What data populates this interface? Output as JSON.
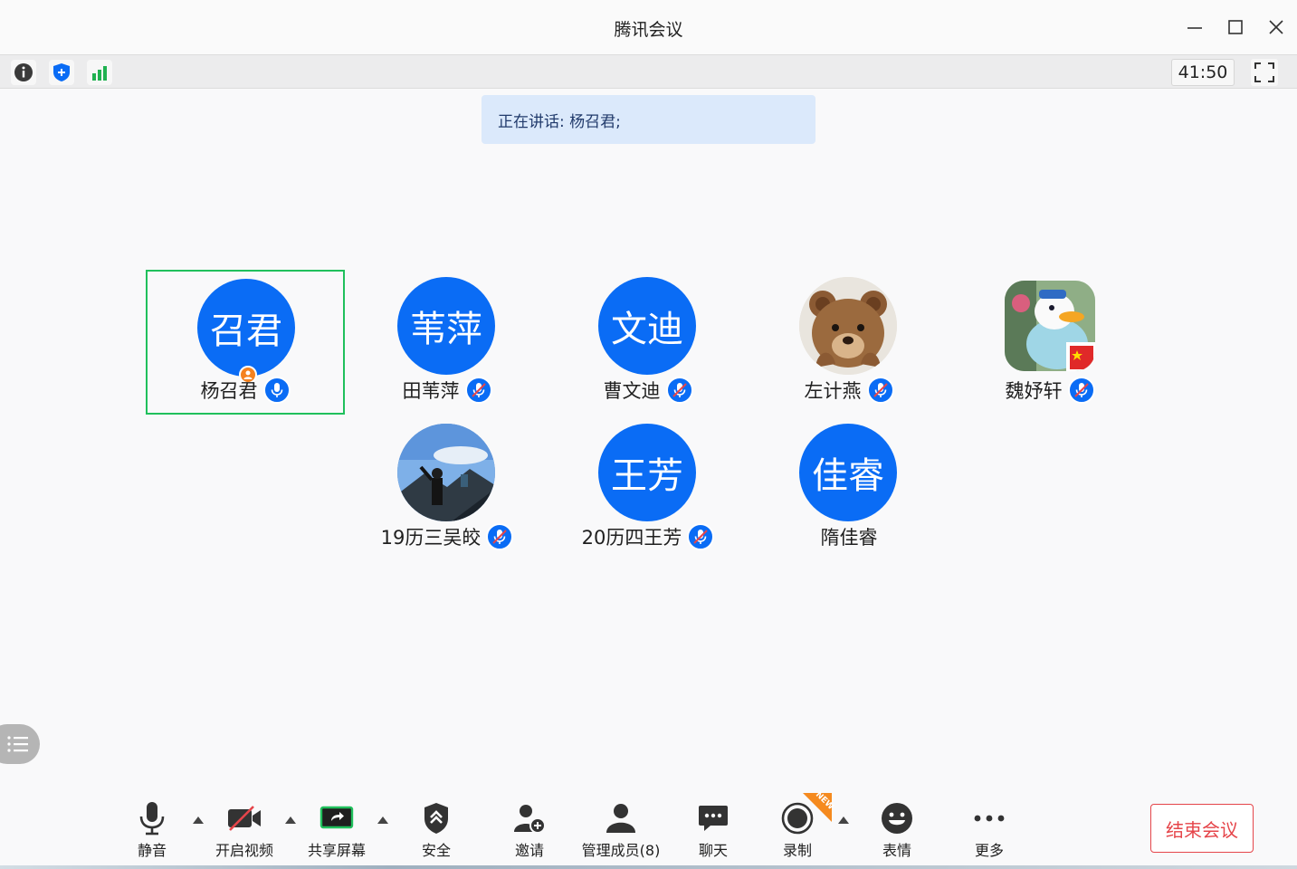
{
  "window": {
    "title": "腾讯会议"
  },
  "infobar": {
    "timer": "41:50"
  },
  "speaking": {
    "text": "正在讲话: 杨召君;"
  },
  "participants": [
    {
      "initials": "召君",
      "name": "杨召君",
      "avatar_type": "initials",
      "mic": "on",
      "host": true,
      "active": true
    },
    {
      "initials": "苇萍",
      "name": "田苇萍",
      "avatar_type": "initials",
      "mic": "muted"
    },
    {
      "initials": "文迪",
      "name": "曹文迪",
      "avatar_type": "initials",
      "mic": "muted"
    },
    {
      "initials": "",
      "name": "左计燕",
      "avatar_type": "photo-teddy-bear",
      "mic": "muted"
    },
    {
      "initials": "",
      "name": "魏妤轩",
      "avatar_type": "photo-donald-duck",
      "mic": "muted"
    },
    {
      "initials": "",
      "name": "19历三吴皎",
      "avatar_type": "photo-mountain",
      "mic": "muted"
    },
    {
      "initials": "王芳",
      "name": "20历四王芳",
      "avatar_type": "initials",
      "mic": "muted"
    },
    {
      "initials": "佳睿",
      "name": "隋佳睿",
      "avatar_type": "initials",
      "mic": "none"
    }
  ],
  "toolbar": {
    "mute": "静音",
    "video": "开启视频",
    "share": "共享屏幕",
    "security": "安全",
    "invite": "邀请",
    "members": "管理成员(8)",
    "chat": "聊天",
    "record": "录制",
    "record_badge": "NEW",
    "reactions": "表情",
    "more": "更多",
    "end": "结束会议"
  },
  "colors": {
    "accent_blue": "#0a6cf5",
    "active_border": "#20c05c",
    "end_red": "#e5454a",
    "host_orange": "#f5821f"
  }
}
